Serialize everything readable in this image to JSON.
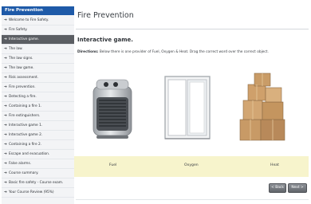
{
  "sidebar": {
    "title": "Fire Prevention",
    "items": [
      {
        "label": "Welcome to Fire Safety."
      },
      {
        "label": "Fire Safety."
      },
      {
        "label": "Interactive game."
      },
      {
        "label": "The law."
      },
      {
        "label": "The law signs."
      },
      {
        "label": "The law game."
      },
      {
        "label": "Risk assessment."
      },
      {
        "label": "Fire prevention."
      },
      {
        "label": "Detecting a fire."
      },
      {
        "label": "Containing a fire 1."
      },
      {
        "label": "Fire extinguishers."
      },
      {
        "label": "Interactive game 1."
      },
      {
        "label": "Interactive game 2."
      },
      {
        "label": "Containing a fire 2."
      },
      {
        "label": "Escape and evacuation."
      },
      {
        "label": "False alarms."
      },
      {
        "label": "Course summary."
      },
      {
        "label": "Basic fire safety - Course exam."
      },
      {
        "label": "Your Course Review (95%)"
      }
    ],
    "active_index": 2,
    "arrow_glyph": "➔"
  },
  "main": {
    "page_title": "Fire Prevention",
    "section_title": "Interactive game.",
    "directions_label": "Directions:",
    "directions_text": "Below there is one provider of Fuel, Oxygen & Heat. Drag the correct word over the correct object.",
    "images": [
      {
        "icon": "heater-icon"
      },
      {
        "icon": "window-icon"
      },
      {
        "icon": "boxes-icon"
      }
    ],
    "drop_labels": {
      "fuel": "Fuel",
      "oxygen": "Oxygen",
      "heat": "Heat"
    },
    "buttons": {
      "back": "< Back",
      "next": "Next >"
    }
  },
  "colors": {
    "header_blue": "#1e5aa8",
    "active_item": "#5b5e63",
    "dropbar_bg": "#f7f4cc"
  }
}
